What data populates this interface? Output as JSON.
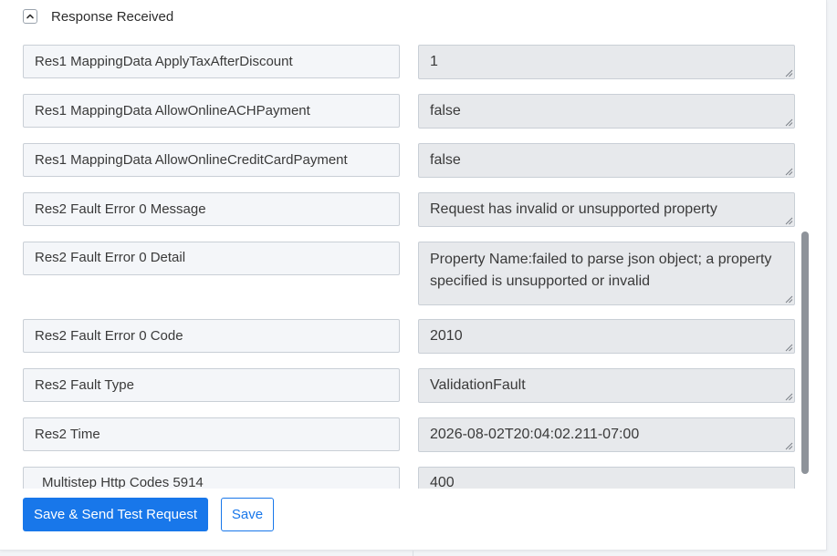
{
  "section": {
    "title": "Response Received",
    "toggle_icon": "chevron-up-icon"
  },
  "rows": [
    {
      "key": "Res1 MappingData ApplyTaxAfterDiscount",
      "value": "1"
    },
    {
      "key": "Res1 MappingData AllowOnlineACHPayment",
      "value": "false"
    },
    {
      "key": "Res1 MappingData AllowOnlineCreditCardPayment",
      "value": "false"
    },
    {
      "key": "Res2 Fault Error 0 Message",
      "value": "Request has invalid or unsupported property"
    },
    {
      "key": "Res2 Fault Error 0 Detail",
      "value": "Property Name:failed to parse json object; a property specified is unsupported or invalid"
    },
    {
      "key": "Res2 Fault Error 0 Code",
      "value": "2010"
    },
    {
      "key": "Res2 Fault Type",
      "value": "ValidationFault"
    },
    {
      "key": "Res2 Time",
      "value": "2026-08-02T20:04:02.211-07:00"
    },
    {
      "key": "Multistep Http Codes 5914",
      "value": "400"
    }
  ],
  "buttons": {
    "send_test": "Save & Send Test Request",
    "save": "Save"
  },
  "colors": {
    "primary": "#1877ea",
    "value_bg": "#e7e9ec",
    "key_bg": "#f4f6f9"
  }
}
